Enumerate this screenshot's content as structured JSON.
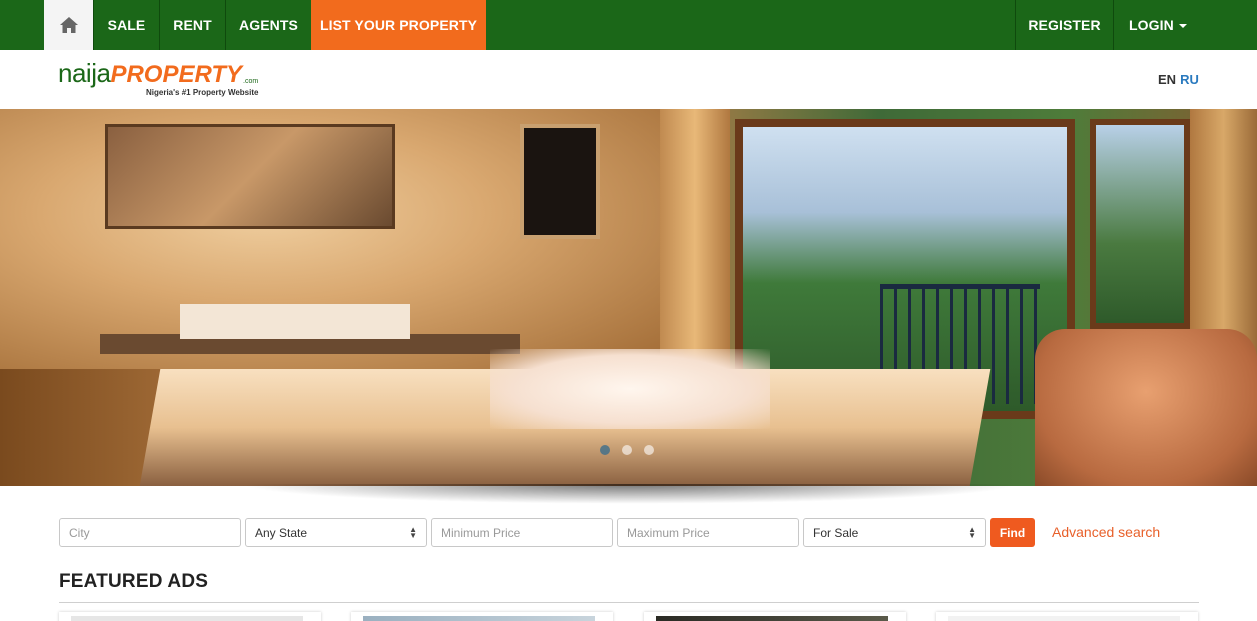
{
  "nav": {
    "home_icon": "home-icon",
    "items": [
      {
        "label": "SALE"
      },
      {
        "label": "RENT"
      },
      {
        "label": "AGENTS"
      },
      {
        "label": "LIST YOUR PROPERTY"
      }
    ],
    "register": "REGISTER",
    "login": "LOGIN",
    "colors": {
      "bar": "#1b6718",
      "highlight": "#f26b1d"
    }
  },
  "header": {
    "logo": {
      "naija": "naija",
      "property": "PROPERTY",
      "com": ".com",
      "tagline": "Nigeria's #1 Property Website"
    },
    "languages": {
      "en": "EN",
      "ru": "RU"
    }
  },
  "carousel": {
    "slides": 3,
    "active_slide": 1
  },
  "search": {
    "city_placeholder": "City",
    "state_value": "Any State",
    "min_price_placeholder": "Minimum Price",
    "max_price_placeholder": "Maximum Price",
    "type_value": "For Sale",
    "find_label": "Find",
    "advanced_label": "Advanced search"
  },
  "featured": {
    "title": "FEATURED ADS"
  }
}
